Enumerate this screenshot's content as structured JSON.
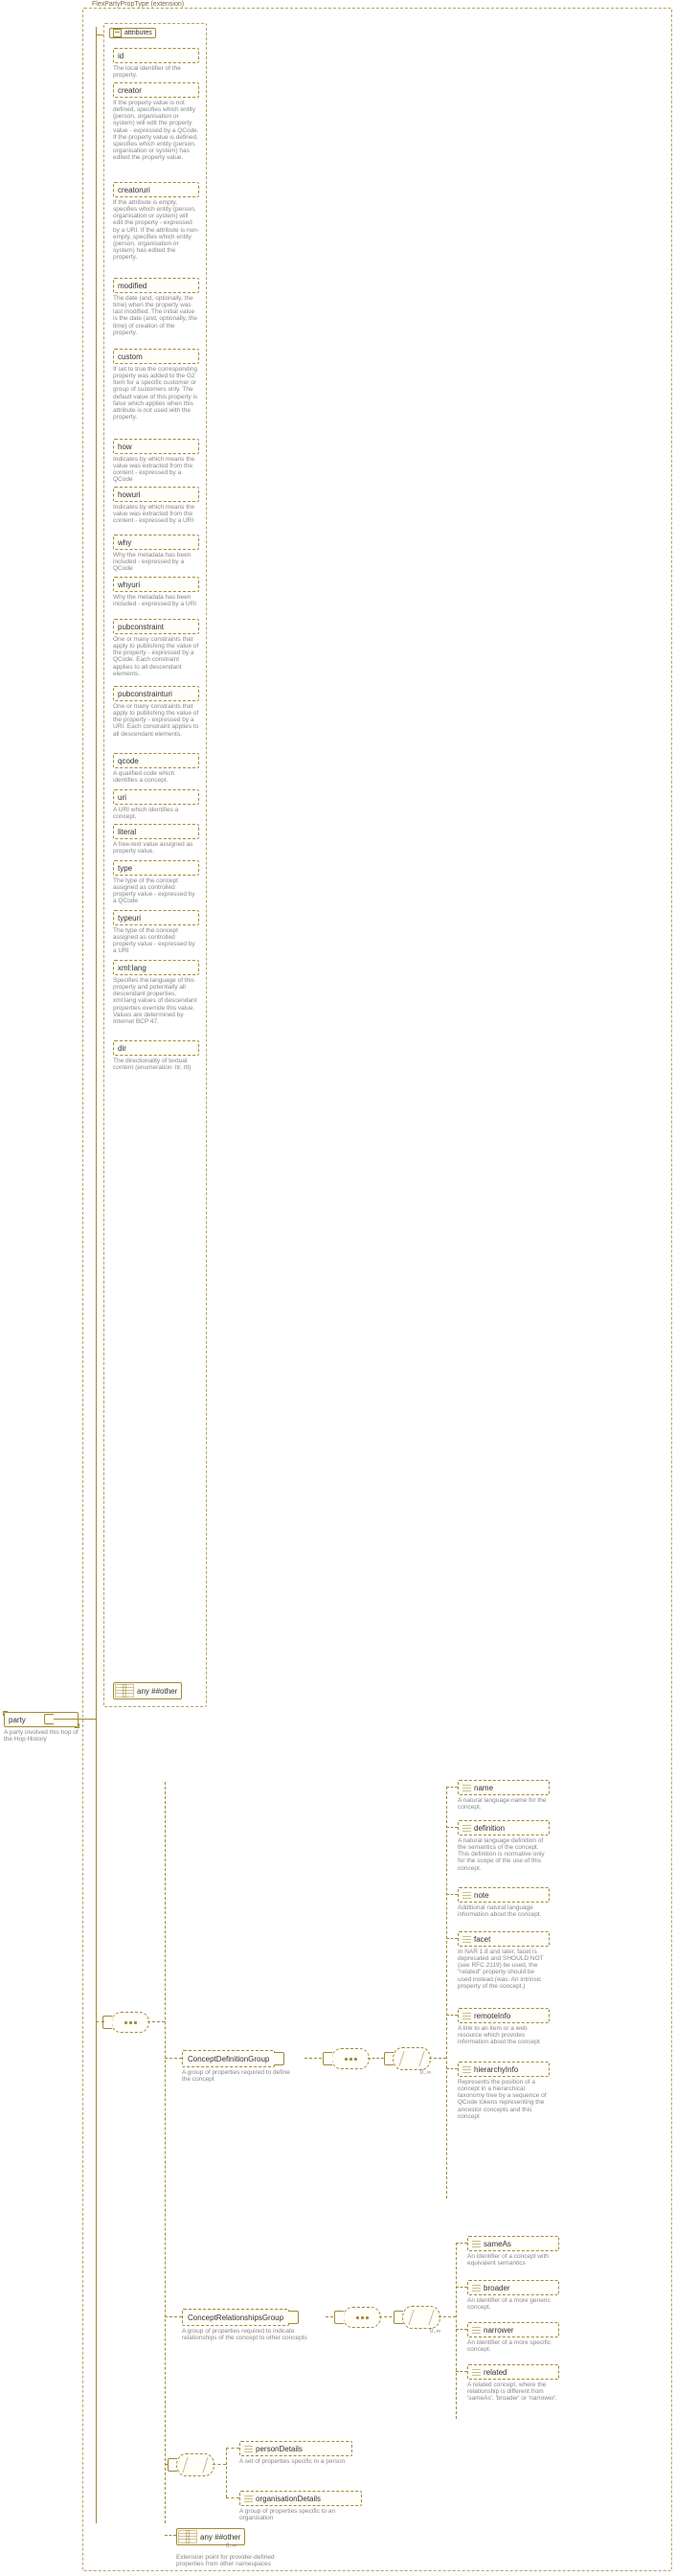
{
  "root": {
    "label": "party",
    "desc": "A party involved this hop of the Hop History"
  },
  "ext": {
    "title": "FlexPartyPropType (extension)",
    "attributes_label": "attributes"
  },
  "attrs": [
    {
      "name": "id",
      "desc": "The local identifier of the property."
    },
    {
      "name": "creator",
      "desc": "If the property value is not defined, specifies which entity (person, organisation or system) will edit the property value - expressed by a QCode. If the property value is defined, specifies which entity (person, organisation or system) has edited the property value."
    },
    {
      "name": "creatoruri",
      "desc": "If the attribute is empty, specifies which entity (person, organisation or system) will edit the property - expressed by a URI. If the attribute is non-empty, specifies which entity (person, organisation or system) has edited the property."
    },
    {
      "name": "modified",
      "desc": "The date (and, optionally, the time) when the property was last modified. The initial value is the date (and, optionally, the time) of creation of the property."
    },
    {
      "name": "custom",
      "desc": "If set to true the corresponding property was added to the G2 Item for a specific customer or group of customers only. The default value of this property is false which applies when this attribute is not used with the property."
    },
    {
      "name": "how",
      "desc": "Indicates by which means the value was extracted from the content - expressed by a QCode"
    },
    {
      "name": "howuri",
      "desc": "Indicates by which means the value was extracted from the content - expressed by a URI"
    },
    {
      "name": "why",
      "desc": "Why the metadata has been included - expressed by a QCode"
    },
    {
      "name": "whyuri",
      "desc": "Why the metadata has been included - expressed by a URI"
    },
    {
      "name": "pubconstraint",
      "desc": "One or many constraints that apply to publishing the value of the property - expressed by a QCode. Each constraint applies to all descendant elements."
    },
    {
      "name": "pubconstrainturi",
      "desc": "One or many constraints that apply to publishing the value of the property - expressed by a URI. Each constraint applies to all descendant elements."
    },
    {
      "name": "qcode",
      "desc": "A qualified code which identifies a concept."
    },
    {
      "name": "uri",
      "desc": "A URI which identifies a concept."
    },
    {
      "name": "literal",
      "desc": "A free-text value assigned as property value."
    },
    {
      "name": "type",
      "desc": "The type of the concept assigned as controlled property value - expressed by a QCode"
    },
    {
      "name": "typeuri",
      "desc": "The type of the concept assigned as controlled property value - expressed by a URI"
    },
    {
      "name": "xml:lang",
      "desc": "Specifies the language of this property and potentially all descendant properties. xml:lang values of descendant properties override this value. Values are determined by Internet BCP 47."
    },
    {
      "name": "dir",
      "desc": "The directionality of textual content (enumeration: ltr, rtl)"
    }
  ],
  "any_other_attr_label": "any ##other",
  "groups": {
    "def": {
      "label": "ConceptDefinitionGroup",
      "desc": "A group of properties required to define the concept",
      "occ": "0..∞",
      "children": [
        {
          "name": "name",
          "desc": "A natural language name for the concept."
        },
        {
          "name": "definition",
          "desc": "A natural language definition of the semantics of the concept. This definition is normative only for the scope of the use of this concept."
        },
        {
          "name": "note",
          "desc": "Additional natural language information about the concept."
        },
        {
          "name": "facet",
          "desc": "In NAR 1.8 and later, facet is deprecated and SHOULD NOT (see RFC 2119) be used, the \"related\" property should be used instead.(was: An intrinsic property of the concept.)"
        },
        {
          "name": "remoteInfo",
          "desc": "A link to an item or a web resource which provides information about the concept"
        },
        {
          "name": "hierarchyInfo",
          "desc": "Represents the position of a concept in a hierarchical taxonomy tree by a sequence of QCode tokens representing the ancestor concepts and this concept"
        }
      ]
    },
    "rel": {
      "label": "ConceptRelationshipsGroup",
      "desc": "A group of properties required to indicate relationships of the concept to other concepts",
      "occ": "0..∞",
      "children": [
        {
          "name": "sameAs",
          "desc": "An identifier of a concept with equivalent semantics"
        },
        {
          "name": "broader",
          "desc": "An identifier of a more generic concept."
        },
        {
          "name": "narrower",
          "desc": "An identifier of a more specific concept."
        },
        {
          "name": "related",
          "desc": "A related concept, where the relationship is different from 'sameAs', 'broader' or 'narrower'."
        }
      ]
    }
  },
  "details": {
    "person": {
      "label": "personDetails",
      "desc": "A set of properties specific to a person"
    },
    "organisation": {
      "label": "organisationDetails",
      "desc": "A group of properties specific to an organisation"
    }
  },
  "tail_any": {
    "label": "any ##other",
    "occ": "0..∞",
    "desc": "Extension point for provider-defined properties from other namespaces"
  },
  "chart_data": {
    "type": "tree",
    "note": "XML schema diagram; nodes and edges derived from rendered boxes and connectors.",
    "attribute_count": 18,
    "groups": {
      "ConceptDefinitionGroup_child_count": 6,
      "ConceptRelationshipsGroup_child_count": 4
    }
  }
}
